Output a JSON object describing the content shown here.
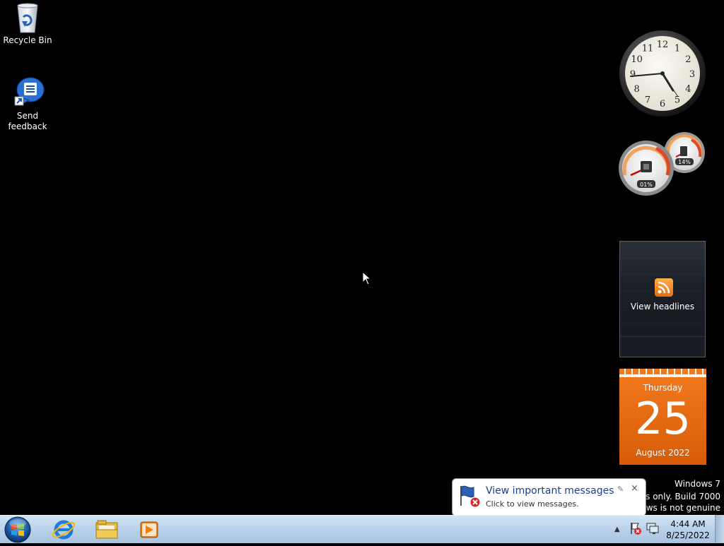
{
  "desktop": {
    "icons": [
      {
        "label": "Recycle Bin"
      },
      {
        "label": "Send feedback"
      }
    ]
  },
  "gadgets": {
    "clock": {
      "numerals": [
        "12",
        "1",
        "2",
        "3",
        "4",
        "5",
        "6",
        "7",
        "8",
        "9",
        "10",
        "11"
      ],
      "time": "4:44"
    },
    "cpu_meter": {
      "cpu_label": "01%",
      "memory_label": "14%",
      "cpu_percent": 1,
      "memory_percent": 14
    },
    "rss": {
      "label": "View headlines"
    },
    "calendar": {
      "day": "Thursday",
      "date": "25",
      "month": "August 2022"
    }
  },
  "watermark": {
    "line1": "Windows 7",
    "line2": "oses only. Build 7000",
    "line3": "dows is not genuine"
  },
  "balloon": {
    "title": "View important messages",
    "body": "Click to view messages.",
    "close": "×"
  },
  "taskbar": {
    "pinned": [
      "internet-explorer",
      "windows-explorer",
      "media-player"
    ],
    "time": "4:44 AM",
    "date": "8/25/2022",
    "tray_arrow": "▲"
  },
  "colors": {
    "taskbar_top": "#d3e4f4",
    "calendar": "#e86a10",
    "balloon_title": "#1e3f8c"
  }
}
